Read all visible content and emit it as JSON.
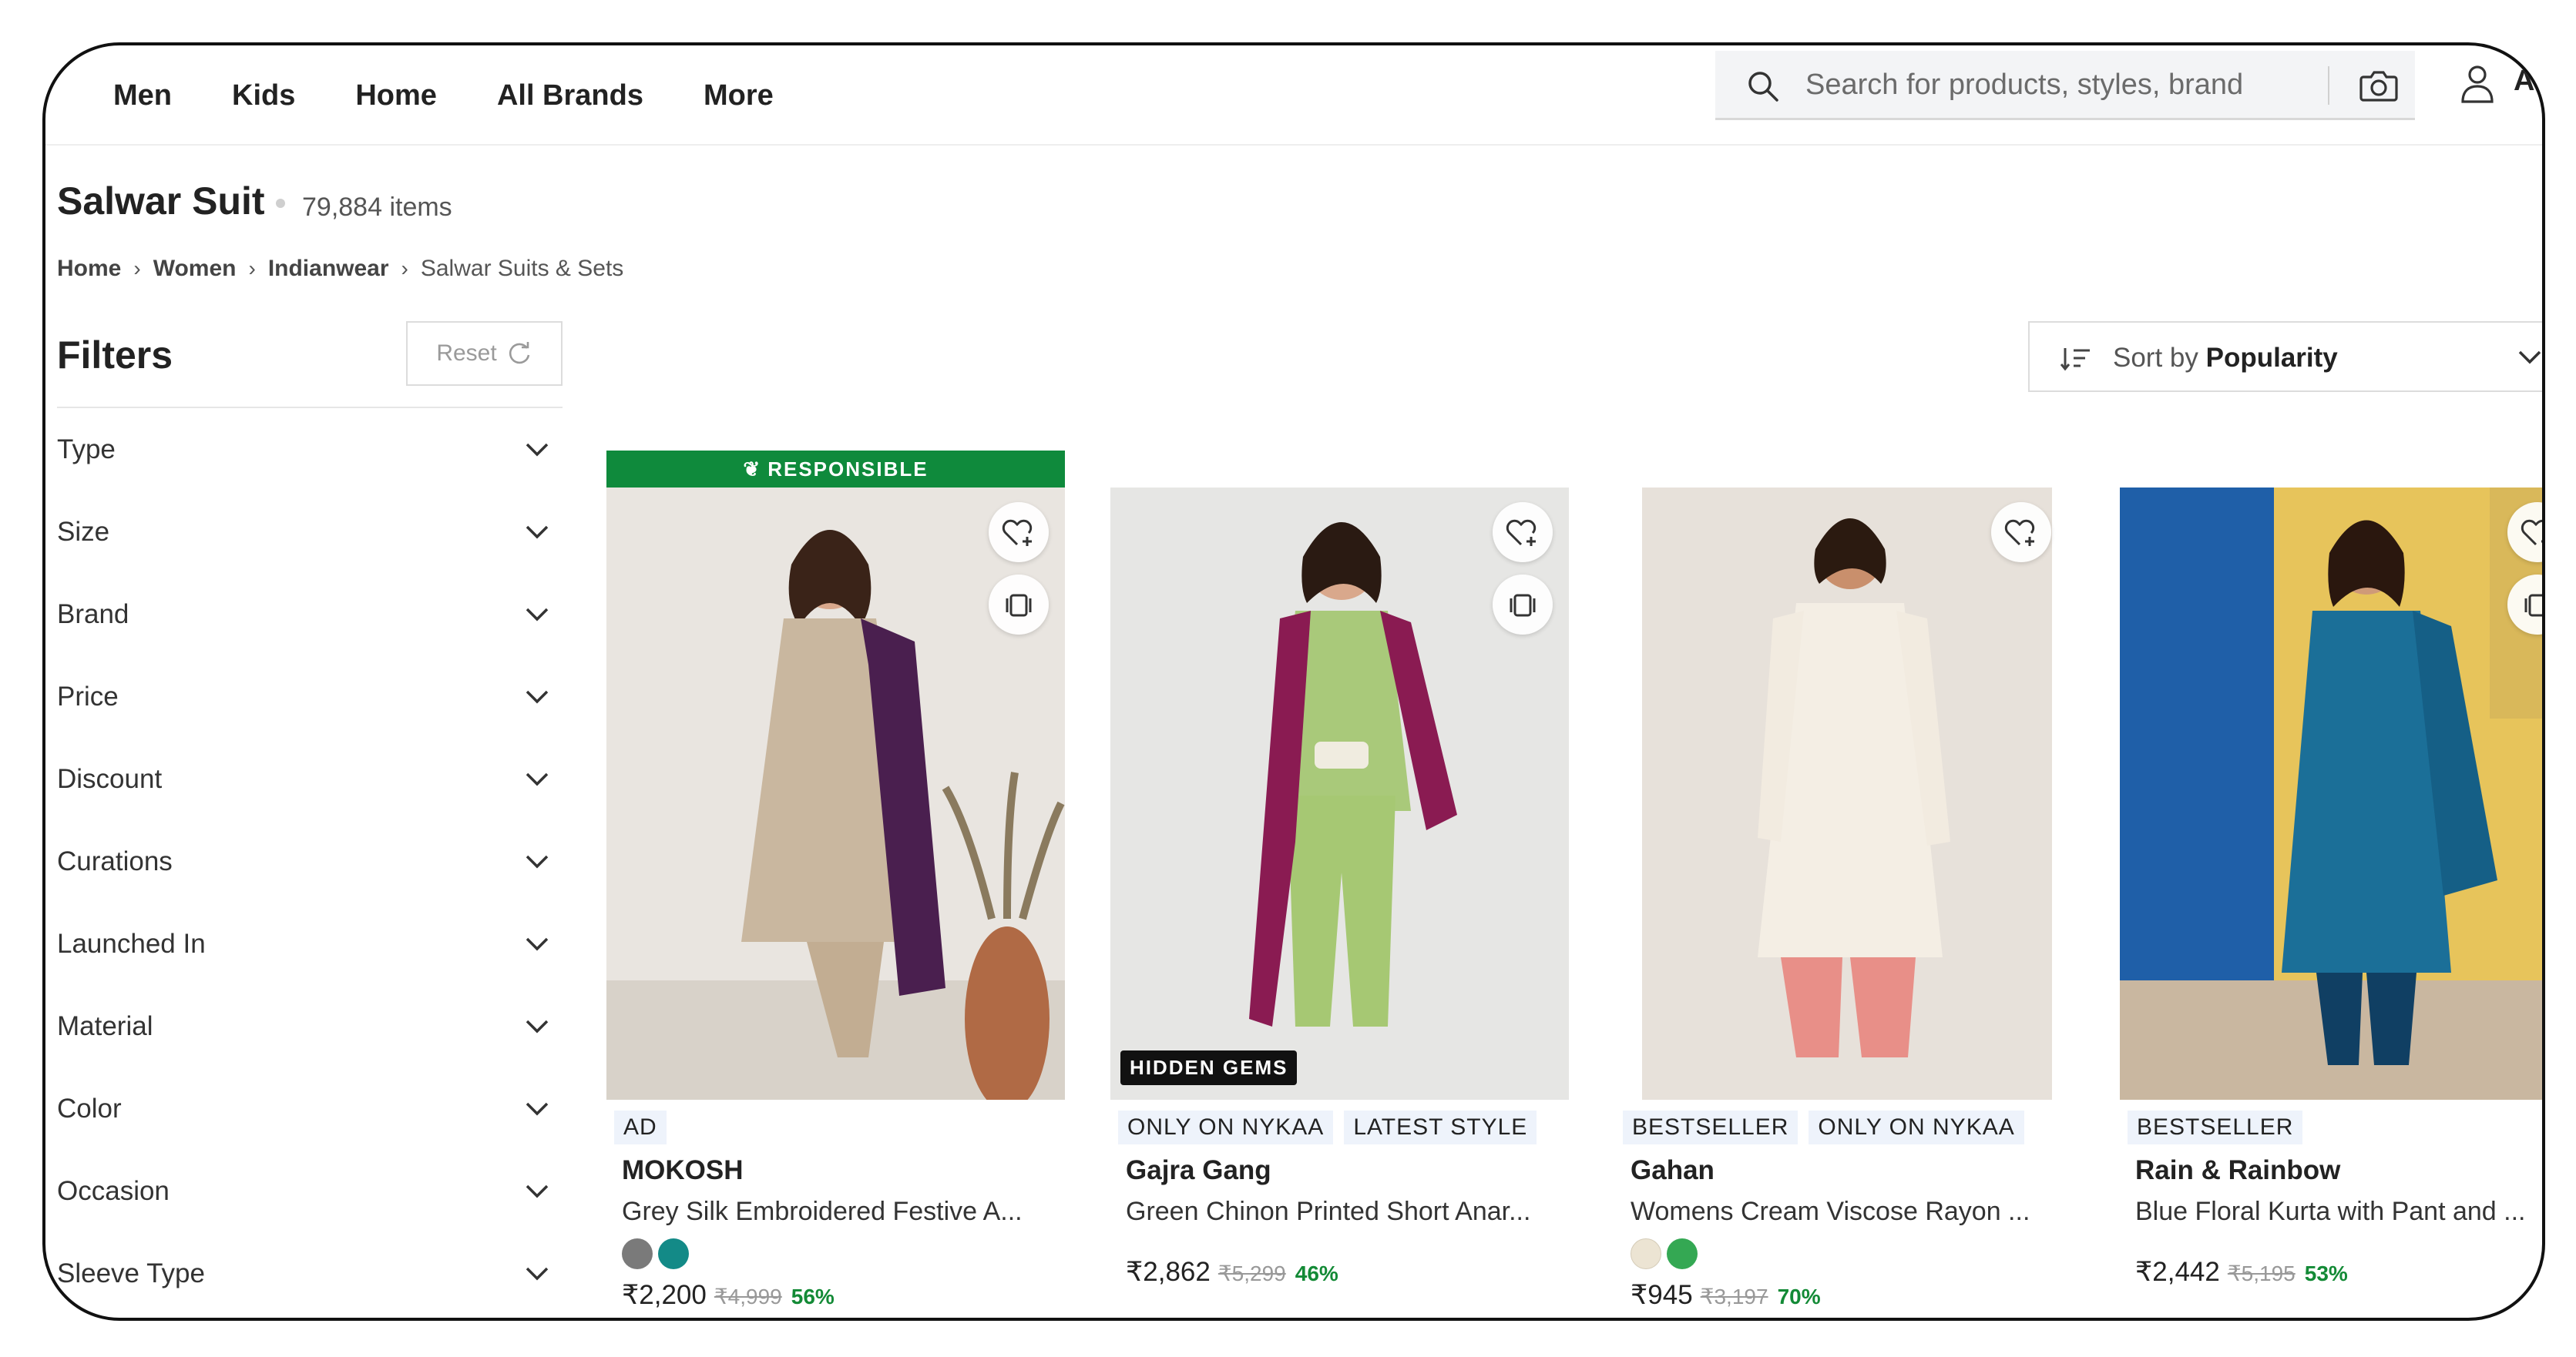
{
  "nav": {
    "links": [
      "Men",
      "Kids",
      "Home",
      "All Brands",
      "More"
    ],
    "search_placeholder": "Search for products, styles, brand",
    "account_initial": "A"
  },
  "page": {
    "title": "Salwar Suit",
    "count": "79,884 items",
    "breadcrumb": [
      "Home",
      "Women",
      "Indianwear",
      "Salwar Suits & Sets"
    ]
  },
  "filters": {
    "title": "Filters",
    "reset_label": "Reset",
    "items": [
      "Type",
      "Size",
      "Brand",
      "Price",
      "Discount",
      "Curations",
      "Launched In",
      "Material",
      "Color",
      "Occasion",
      "Sleeve Type"
    ]
  },
  "sort": {
    "prefix": "Sort by",
    "value": "Popularity"
  },
  "products": [
    {
      "banner": "RESPONSIBLE",
      "tags": [
        "AD"
      ],
      "brand": "MOKOSH",
      "name": "Grey Silk Embroidered Festive A...",
      "swatches": [
        "#7a7a7a",
        "#138a87"
      ],
      "price": "₹2,200",
      "mrp": "₹4,999",
      "discount": "56%"
    },
    {
      "badge": "HIDDEN GEMS",
      "tags": [
        "ONLY ON NYKAA",
        "LATEST STYLE"
      ],
      "brand": "Gajra Gang",
      "name": "Green Chinon Printed Short Anar...",
      "price": "₹2,862",
      "mrp": "₹5,299",
      "discount": "46%"
    },
    {
      "tags": [
        "BESTSELLER",
        "ONLY ON NYKAA"
      ],
      "brand": "Gahan",
      "name": "Womens Cream Viscose Rayon ...",
      "swatches": [
        "#ece4d3",
        "#34a853"
      ],
      "price": "₹945",
      "mrp": "₹3,197",
      "discount": "70%"
    },
    {
      "tags": [
        "BESTSELLER"
      ],
      "brand": "Rain & Rainbow",
      "name": "Blue Floral Kurta with Pant and ...",
      "price": "₹2,442",
      "mrp": "₹5,195",
      "discount": "53%"
    }
  ]
}
